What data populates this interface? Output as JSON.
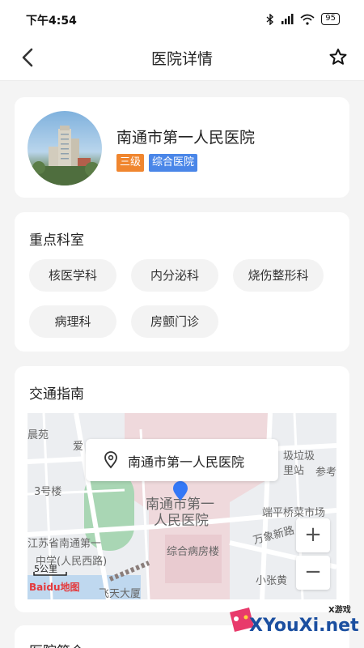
{
  "status_bar": {
    "time": "下午4:54",
    "battery": "95",
    "icons": [
      "bluetooth-icon",
      "signal-icon",
      "wifi-icon",
      "battery-icon"
    ]
  },
  "nav": {
    "title": "医院详情",
    "back_icon": "chevron-left-icon",
    "favorite_icon": "star-outline-icon"
  },
  "hospital": {
    "name": "南通市第一人民医院",
    "level": "三级",
    "type": "综合医院"
  },
  "departments": {
    "title": "重点科室",
    "items": [
      "核医学科",
      "内分泌科",
      "烧伤整形科",
      "病理科",
      "房颤门诊"
    ]
  },
  "traffic": {
    "title": "交通指南",
    "callout_name": "南通市第一人民医院",
    "map_labels": {
      "l1": "晨苑",
      "l2": "爱",
      "l3": "3号楼",
      "l4": "南通市第一",
      "l5": "人民医院",
      "l6": "江苏省南通第一",
      "l7": "中学(人民西路)",
      "l8": "综合病房楼",
      "l9": "端平桥菜市场",
      "l10": "万象新路",
      "l11": "小张黄",
      "l12": "圾垃圾",
      "l13": "里站",
      "l14": "参考",
      "l15": "飞天大厦"
    },
    "zoom_in": "+",
    "zoom_out": "−",
    "scale": "5公里",
    "map_provider": "Baidu地图"
  },
  "intro": {
    "title": "医院简介"
  },
  "watermark": {
    "text": "XYouXi.net",
    "small": "X游戏"
  },
  "colors": {
    "level_badge": "#f0862f",
    "type_badge": "#4a86e8",
    "map_pin": "#3478f6"
  }
}
